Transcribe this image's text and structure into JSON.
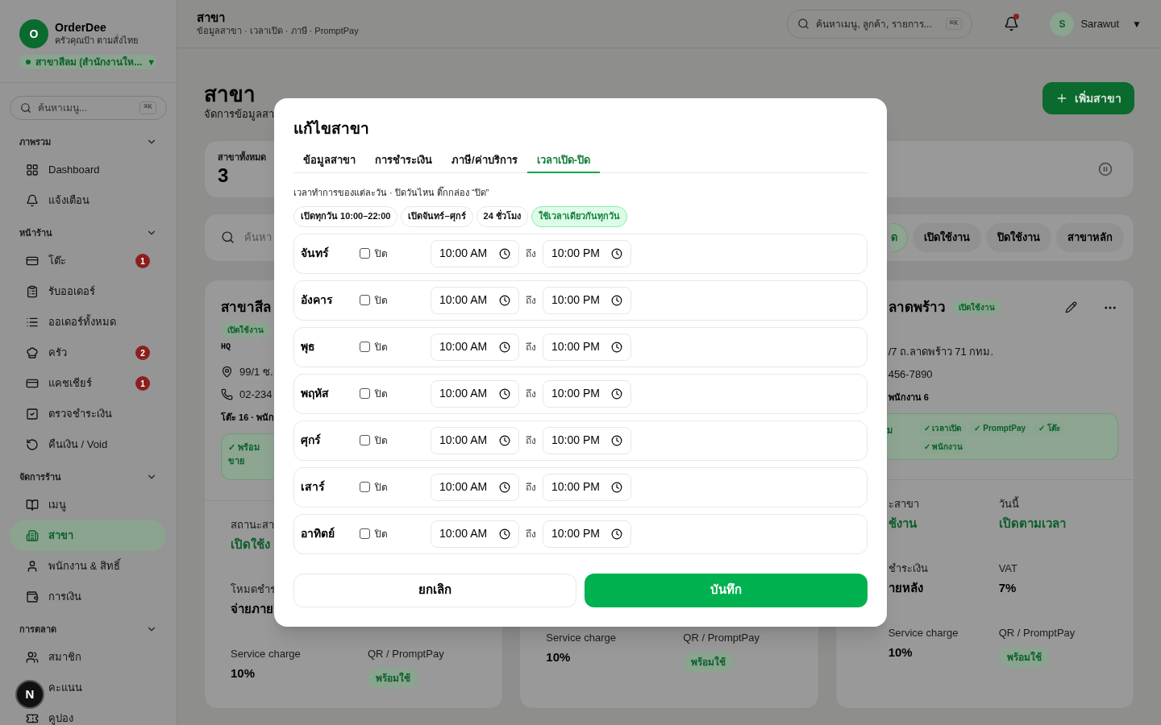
{
  "app": {
    "avatar_letter": "O",
    "name": "OrderDee",
    "tagline": "ครัวคุณป้า ตามสั่งไทย"
  },
  "branch_selector": {
    "label": "สาขาสีลม (สำนักงานให...",
    "caret": "▼"
  },
  "sidebar": {
    "search": {
      "placeholder": "ค้นหาเมนู...",
      "shortcut": "⌘K"
    },
    "sections": [
      {
        "title": "ภาพรวม",
        "expanded": true,
        "items": [
          {
            "label": "Dashboard",
            "selected": false
          },
          {
            "label": "แจ้งเตือน",
            "selected": false
          }
        ]
      },
      {
        "title": "หน้าร้าน",
        "expanded": true,
        "items": [
          {
            "label": "โต๊ะ",
            "selected": false,
            "badge": "1"
          },
          {
            "label": "รับออเดอร์",
            "selected": false
          },
          {
            "label": "ออเดอร์ทั้งหมด",
            "selected": false
          },
          {
            "label": "ครัว",
            "selected": false,
            "badge": "2"
          },
          {
            "label": "แคชเชียร์",
            "selected": false,
            "badge": "1"
          },
          {
            "label": "ตรวจชำระเงิน",
            "selected": false
          },
          {
            "label": "คืนเงิน / Void",
            "selected": false
          }
        ]
      },
      {
        "title": "จัดการร้าน",
        "expanded": true,
        "items": [
          {
            "label": "เมนู",
            "selected": false
          },
          {
            "label": "สาขา",
            "selected": true
          },
          {
            "label": "พนักงาน & สิทธิ์",
            "selected": false
          },
          {
            "label": "การเงิน",
            "selected": false
          }
        ]
      },
      {
        "title": "การตลาด",
        "expanded": true,
        "items": [
          {
            "label": "สมาชิก",
            "selected": false
          },
          {
            "label": "คะแนน",
            "selected": false
          },
          {
            "label": "คูปอง",
            "selected": false
          }
        ]
      }
    ]
  },
  "dev_indicator": {
    "letter": "N"
  },
  "topbar": {
    "title": "สาขา",
    "breadcrumb": "ข้อมูลสาขา · เวลาเปิด · ภาษี · PromptPay",
    "search": {
      "placeholder": "ค้นหาเมนู, ลูกค้า, รายการ...",
      "shortcut": "⌘K"
    },
    "notifications_unread": true,
    "user": {
      "avatar_letter": "S",
      "name": "Sarawut",
      "caret": "▼"
    }
  },
  "page": {
    "title": "สาขา",
    "subtitle": "จัดการข้อมูลสา",
    "add_button": "เพิ่มสาขา"
  },
  "stats": {
    "label": "สาขาทั้งหมด",
    "value": "3"
  },
  "filters": {
    "search_placeholder": "ค้นหา",
    "chips": [
      {
        "label": "ด",
        "selected": true
      },
      {
        "label": "เปิดใช้งาน",
        "selected": false
      },
      {
        "label": "ปิดใช้งาน",
        "selected": false
      },
      {
        "label": "สาขาหลัก",
        "selected": false
      }
    ]
  },
  "branches": [
    {
      "title": "สาขาสีล",
      "status": "เปิดใช้งาน",
      "hq": "HQ",
      "address": "99/1 ซ.",
      "phone": "02-234",
      "meta": "โต๊ะ 16 · พนัก",
      "ready": "✓ พร้อมขาย",
      "stats": [
        {
          "label": "สถานะสา",
          "value": "เปิดใช้ง",
          "kind": "accent"
        },
        {
          "label": "โหมดชำร",
          "value": "จ่ายภาย",
          "kind": "text"
        },
        {
          "label": "Service charge",
          "value": "10%",
          "kind": "text"
        },
        {
          "label": "QR / PromptPay",
          "value": "พร้อมใช้",
          "kind": "badge"
        }
      ]
    },
    {
      "stats": [
        {
          "label": "Service charge",
          "value": "10%",
          "kind": "text"
        },
        {
          "label": "QR / PromptPay",
          "value": "พร้อมใช้",
          "kind": "badge"
        }
      ]
    },
    {
      "title": "ลาดพร้าว",
      "status": "เปิดใช้งาน",
      "actions": true,
      "address": "/7 ถ.ลาดพร้าว 71 กทม.",
      "phone": "456-7890",
      "meta": "พนักงาน 6",
      "ready": "ม",
      "ready_chips": [
        "✓ เวลาเปิด",
        "✓ PromptPay",
        "✓ โต๊ะ",
        "✓ พนักงาน"
      ],
      "stats": [
        {
          "label": "ะสาขา",
          "value": "ช้งาน",
          "kind": "accent"
        },
        {
          "label": "วันนี้",
          "value": "เปิดตามเวลา",
          "kind": "accent"
        },
        {
          "label": "ชำระเงิน",
          "value": "ายหลัง",
          "kind": "text"
        },
        {
          "label": "VAT",
          "value": "7%",
          "kind": "text"
        },
        {
          "label": "Service charge",
          "value": "10%",
          "kind": "text"
        },
        {
          "label": "QR / PromptPay",
          "value": "พร้อมใช้",
          "kind": "badge"
        }
      ]
    }
  ],
  "dialog": {
    "title": "แก้ไขสาขา",
    "tabs": [
      {
        "label": "ข้อมูลสาขา",
        "selected": false
      },
      {
        "label": "การชำระเงิน",
        "selected": false
      },
      {
        "label": "ภาษี/ค่าบริการ",
        "selected": false
      },
      {
        "label": "เวลาเปิด-ปิด",
        "selected": true
      }
    ],
    "hint": "เวลาทำการของแต่ละวัน · ปิดวันไหน ติ๊กกล่อง “ปิด”",
    "presets": [
      {
        "label": "เปิดทุกวัน 10:00–22:00",
        "selected": false
      },
      {
        "label": "เปิดจันทร์–ศุกร์",
        "selected": false
      },
      {
        "label": "24 ชั่วโมง",
        "selected": false
      },
      {
        "label": "ใช้เวลาเดียวกันทุกวัน",
        "selected": true
      }
    ],
    "days": [
      {
        "name": "จันทร์",
        "closed": false,
        "closed_label": "ปิด",
        "open": "10:00 AM",
        "to": "ถึง",
        "close": "10:00 PM"
      },
      {
        "name": "อังคาร",
        "closed": false,
        "closed_label": "ปิด",
        "open": "10:00 AM",
        "to": "ถึง",
        "close": "10:00 PM"
      },
      {
        "name": "พุธ",
        "closed": false,
        "closed_label": "ปิด",
        "open": "10:00 AM",
        "to": "ถึง",
        "close": "10:00 PM"
      },
      {
        "name": "พฤหัส",
        "closed": false,
        "closed_label": "ปิด",
        "open": "10:00 AM",
        "to": "ถึง",
        "close": "10:00 PM"
      },
      {
        "name": "ศุกร์",
        "closed": false,
        "closed_label": "ปิด",
        "open": "10:00 AM",
        "to": "ถึง",
        "close": "10:00 PM"
      },
      {
        "name": "เสาร์",
        "closed": false,
        "closed_label": "ปิด",
        "open": "10:00 AM",
        "to": "ถึง",
        "close": "10:00 PM"
      },
      {
        "name": "อาทิตย์",
        "closed": false,
        "closed_label": "ปิด",
        "open": "10:00 AM",
        "to": "ถึง",
        "close": "10:00 PM"
      }
    ],
    "cancel": "ยกเลิก",
    "save": "บันทึก"
  }
}
